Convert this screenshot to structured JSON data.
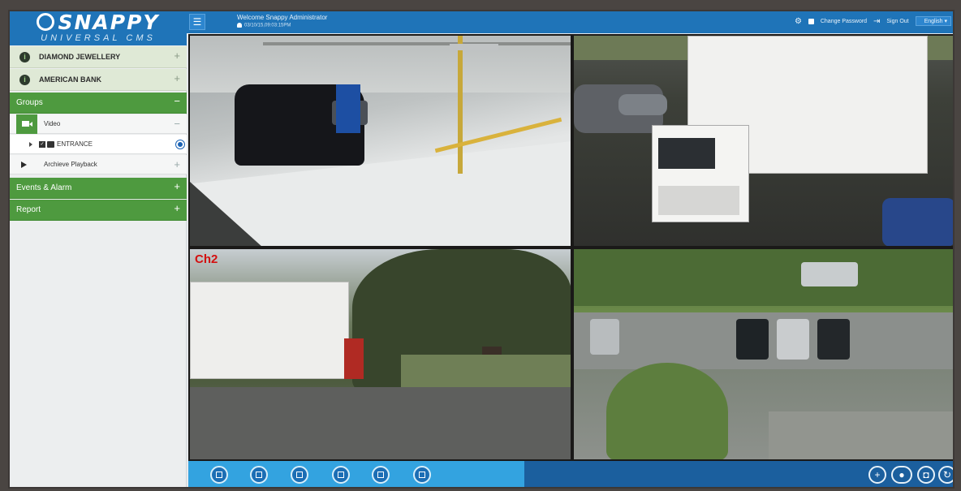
{
  "brand": {
    "logo_text": "SNAPPY",
    "logo_sub": "UNIVERSAL CMS"
  },
  "topbar": {
    "welcome": "Welcome Snappy Administrator",
    "datetime": "03/10/15,09:03:15PM",
    "change_password": "Change Password",
    "sign_out": "Sign Out",
    "language": "English"
  },
  "sidebar": {
    "clients": [
      {
        "label": "DIAMOND JEWELLERY"
      },
      {
        "label": "AMERICAN BANK"
      }
    ],
    "groups": {
      "label": "Groups",
      "toggle": "−"
    },
    "video": {
      "label": "Video",
      "toggle": "−"
    },
    "entrance": {
      "label": "ENTRANCE"
    },
    "archive": {
      "label": "Archieve Playback",
      "toggle": "+"
    },
    "events": {
      "label": "Events & Alarm",
      "toggle": "+"
    },
    "report": {
      "label": "Report",
      "toggle": "+"
    },
    "plus": "+"
  },
  "video_grid": {
    "tiles": [
      {
        "channel_label": ""
      },
      {
        "channel_label": ""
      },
      {
        "channel_label": "Ch2"
      },
      {
        "channel_label": ""
      }
    ]
  },
  "bottom": {
    "layouts": [
      "single-view-icon",
      "quad-view-icon",
      "nine-view-icon",
      "sixteen-view-icon",
      "layout-25-icon",
      "layout-36-icon"
    ],
    "controls": [
      "zoom-in-icon",
      "camera-group-icon",
      "snapshot-icon",
      "refresh-icon"
    ]
  },
  "colors": {
    "brand_blue": "#1f74b8",
    "group_green": "#4e9a3f",
    "bottom_light": "#33a3e0",
    "bottom_dark": "#1b5f9e"
  }
}
